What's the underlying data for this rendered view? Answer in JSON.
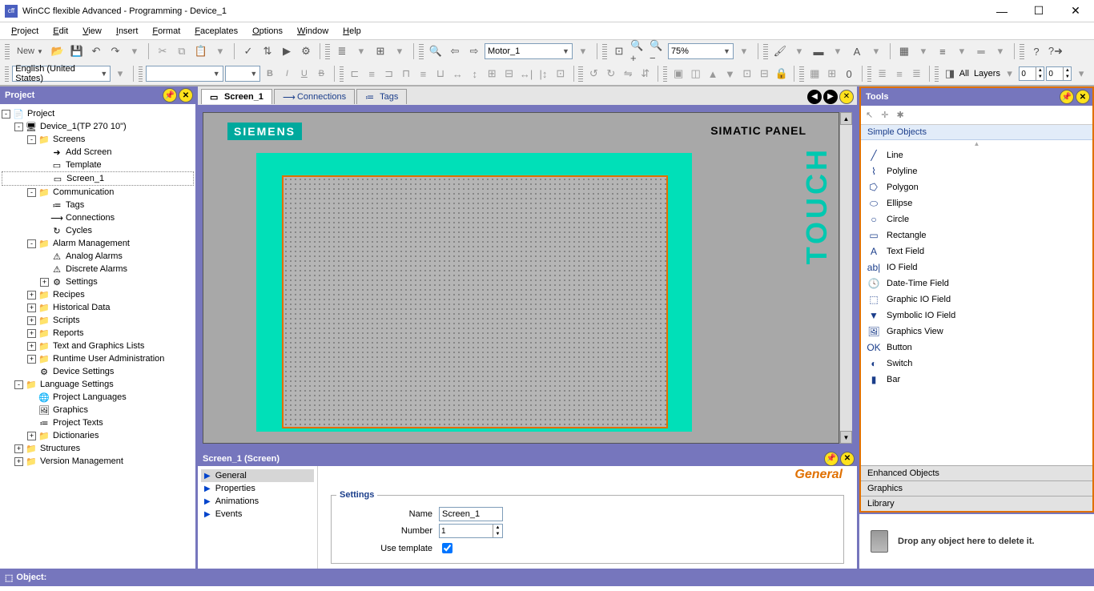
{
  "title": "WinCC flexible Advanced - Programming - Device_1",
  "menu": [
    "Project",
    "Edit",
    "View",
    "Insert",
    "Format",
    "Faceplates",
    "Options",
    "Window",
    "Help"
  ],
  "toolbar": {
    "new": "New",
    "motor_combo": "Motor_1",
    "zoom": "75%",
    "lang_combo": "English (United States)",
    "all": "All",
    "layers": "Layers",
    "spin1": "0",
    "spin2": "0"
  },
  "project_panel": {
    "title": "Project",
    "tree": [
      {
        "depth": 0,
        "exp": "-",
        "icon": "📄",
        "label": "Project"
      },
      {
        "depth": 1,
        "exp": "-",
        "icon": "🖥",
        "label": "Device_1(TP 270 10\")"
      },
      {
        "depth": 2,
        "exp": "-",
        "icon": "📁",
        "cls": "folder-yellow",
        "label": "Screens"
      },
      {
        "depth": 3,
        "exp": "",
        "icon": "➜",
        "label": "Add Screen"
      },
      {
        "depth": 3,
        "exp": "",
        "icon": "▭",
        "label": "Template"
      },
      {
        "depth": 3,
        "exp": "",
        "icon": "▭",
        "label": "Screen_1",
        "sel": true
      },
      {
        "depth": 2,
        "exp": "-",
        "icon": "📁",
        "cls": "folder-yellow",
        "label": "Communication"
      },
      {
        "depth": 3,
        "exp": "",
        "icon": "≔",
        "label": "Tags"
      },
      {
        "depth": 3,
        "exp": "",
        "icon": "⟶",
        "label": "Connections"
      },
      {
        "depth": 3,
        "exp": "",
        "icon": "↻",
        "label": "Cycles"
      },
      {
        "depth": 2,
        "exp": "-",
        "icon": "📁",
        "cls": "folder-yellow",
        "label": "Alarm Management"
      },
      {
        "depth": 3,
        "exp": "",
        "icon": "⚠",
        "label": "Analog Alarms"
      },
      {
        "depth": 3,
        "exp": "",
        "icon": "⚠",
        "label": "Discrete Alarms"
      },
      {
        "depth": 3,
        "exp": "+",
        "icon": "⚙",
        "label": "Settings"
      },
      {
        "depth": 2,
        "exp": "+",
        "icon": "📁",
        "cls": "folder-yellow",
        "label": "Recipes"
      },
      {
        "depth": 2,
        "exp": "+",
        "icon": "📁",
        "cls": "folder-yellow",
        "label": "Historical Data"
      },
      {
        "depth": 2,
        "exp": "+",
        "icon": "📁",
        "cls": "folder-yellow",
        "label": "Scripts"
      },
      {
        "depth": 2,
        "exp": "+",
        "icon": "📁",
        "cls": "folder-yellow",
        "label": "Reports"
      },
      {
        "depth": 2,
        "exp": "+",
        "icon": "📁",
        "cls": "folder-yellow",
        "label": "Text and Graphics Lists"
      },
      {
        "depth": 2,
        "exp": "+",
        "icon": "📁",
        "cls": "folder-yellow",
        "label": "Runtime User Administration"
      },
      {
        "depth": 2,
        "exp": "",
        "icon": "⚙",
        "label": "Device Settings"
      },
      {
        "depth": 1,
        "exp": "-",
        "icon": "📁",
        "cls": "folder-yellow",
        "label": "Language Settings"
      },
      {
        "depth": 2,
        "exp": "",
        "icon": "🌐",
        "label": "Project Languages"
      },
      {
        "depth": 2,
        "exp": "",
        "icon": "🖼",
        "label": "Graphics"
      },
      {
        "depth": 2,
        "exp": "",
        "icon": "≔",
        "label": "Project Texts"
      },
      {
        "depth": 2,
        "exp": "+",
        "icon": "📁",
        "cls": "folder-yellow",
        "label": "Dictionaries"
      },
      {
        "depth": 1,
        "exp": "+",
        "icon": "📁",
        "cls": "folder-yellow",
        "label": "Structures"
      },
      {
        "depth": 1,
        "exp": "+",
        "icon": "📁",
        "cls": "folder-yellow",
        "label": "Version Management"
      }
    ]
  },
  "tabs": [
    {
      "label": "Screen_1",
      "active": true,
      "icon": "▭"
    },
    {
      "label": "Connections",
      "active": false,
      "icon": "⟶"
    },
    {
      "label": "Tags",
      "active": false,
      "icon": "≔"
    }
  ],
  "canvas": {
    "brand": "SIEMENS",
    "panel_label": "SIMATIC PANEL",
    "touch": "TOUCH"
  },
  "props": {
    "title": "Screen_1 (Screen)",
    "nav": [
      "General",
      "Properties",
      "Animations",
      "Events"
    ],
    "section_title": "General",
    "fieldset": "Settings",
    "name_lbl": "Name",
    "name_val": "Screen_1",
    "number_lbl": "Number",
    "number_val": "1",
    "use_tpl_lbl": "Use template",
    "use_tpl_checked": true
  },
  "tools": {
    "title": "Tools",
    "simple_hdr": "Simple Objects",
    "items": [
      {
        "icon": "╱",
        "label": "Line"
      },
      {
        "icon": "⌇",
        "label": "Polyline"
      },
      {
        "icon": "⭔",
        "label": "Polygon"
      },
      {
        "icon": "⬭",
        "label": "Ellipse"
      },
      {
        "icon": "○",
        "label": "Circle"
      },
      {
        "icon": "▭",
        "label": "Rectangle"
      },
      {
        "icon": "A",
        "label": "Text Field"
      },
      {
        "icon": "ab|",
        "label": "IO Field"
      },
      {
        "icon": "🕓",
        "label": "Date-Time Field"
      },
      {
        "icon": "⬚",
        "label": "Graphic IO Field"
      },
      {
        "icon": "▼",
        "label": "Symbolic IO Field"
      },
      {
        "icon": "🖼",
        "label": "Graphics View"
      },
      {
        "icon": "OK",
        "label": "Button"
      },
      {
        "icon": "◐",
        "label": "Switch"
      },
      {
        "icon": "▮",
        "label": "Bar"
      }
    ],
    "accordion": [
      "Enhanced Objects",
      "Graphics",
      "Library"
    ],
    "trash_text": "Drop any object here to delete it."
  },
  "statusbar": {
    "label": "Object:"
  }
}
